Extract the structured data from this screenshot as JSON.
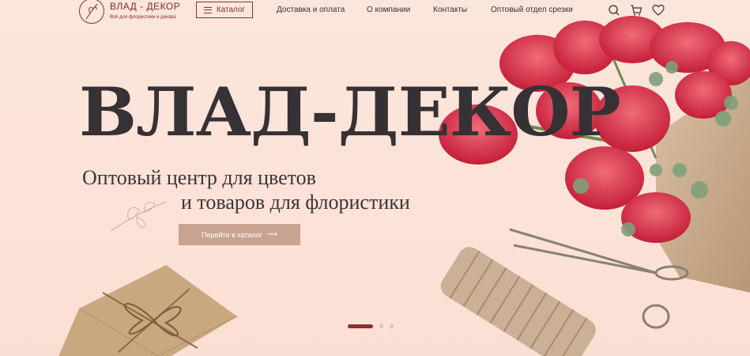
{
  "logo": {
    "title": "ВЛАД - ДЕКОР",
    "subtitle": "Всё для флористики и декора"
  },
  "header": {
    "catalog_label": "Каталог",
    "nav": [
      "Доставка и оплата",
      "О компании",
      "Контакты",
      "Оптовый отдел срезки"
    ],
    "icons": [
      "search-icon",
      "cart-icon",
      "heart-icon"
    ]
  },
  "hero": {
    "title": "ВЛАД-ДЕКОР",
    "subtitle_line1": "Оптовый центр для цветов",
    "subtitle_line2": "и товаров для флористики",
    "cta_label": "Перейти в каталог",
    "cta_arrow": "⟶"
  },
  "slider": {
    "slides": 3,
    "active_index": 0
  },
  "colors": {
    "brand": "#8b2f33",
    "cta": "#c9a391",
    "background": "#fbe4da"
  }
}
